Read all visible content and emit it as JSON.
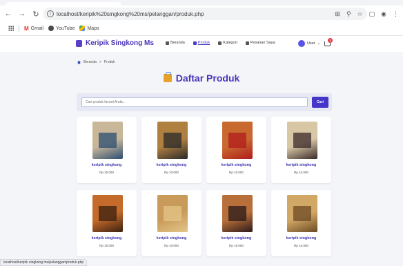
{
  "browser": {
    "url": "localhost/keripik%20singkong%20ms/pelanggan/produk.php",
    "bookmarks": [
      {
        "label": "Gmail",
        "icon": "gmail-icon"
      },
      {
        "label": "YouTube",
        "icon": "youtube-icon"
      },
      {
        "label": "Maps",
        "icon": "maps-icon"
      }
    ],
    "status_url": "localhost/keripik singkong ms/pelanggan/produk.php"
  },
  "site": {
    "brand": "Keripik Singkong Ms",
    "nav": [
      {
        "label": "Beranda",
        "active": false
      },
      {
        "label": "Produk",
        "active": true
      },
      {
        "label": "Kategori",
        "active": false
      },
      {
        "label": "Pesanan Saya",
        "active": false
      }
    ],
    "user_label": "User",
    "cart_count": "1"
  },
  "breadcrumb": {
    "home": "Beranda",
    "separator": ">",
    "current": "Produk"
  },
  "page_title": "Daftar Produk",
  "search": {
    "placeholder": "Cari produk favorit Anda...",
    "button_label": "Cari"
  },
  "products": [
    {
      "name": "keripik singkong",
      "price": "Rp 10.000",
      "colors": [
        "#c9b79a",
        "#2c4e72"
      ]
    },
    {
      "name": "keripik singkong",
      "price": "Rp 10.000",
      "colors": [
        "#b08040",
        "#2a2a2a"
      ]
    },
    {
      "name": "keripik singkong",
      "price": "Rp 10.000",
      "colors": [
        "#c86a30",
        "#b01c1c"
      ]
    },
    {
      "name": "keripik singkong",
      "price": "Rp 10.000",
      "colors": [
        "#d8c7a5",
        "#3a2a2a"
      ]
    },
    {
      "name": "keripik singkong",
      "price": "Rp 10.000",
      "colors": [
        "#c46a2a",
        "#3a2010"
      ]
    },
    {
      "name": "keripik singkong",
      "price": "Rp 10.000",
      "colors": [
        "#c99b5a",
        "#e3c58a"
      ]
    },
    {
      "name": "keripik singkong",
      "price": "Rp 10.000",
      "colors": [
        "#b8703a",
        "#2a1a1a"
      ]
    },
    {
      "name": "keripik singkong",
      "price": "Rp 10.000",
      "colors": [
        "#d2a866",
        "#6b4a24"
      ]
    }
  ],
  "colors": {
    "accent": "#4a35b8",
    "button": "#4536c9",
    "background": "#f4f5f9"
  }
}
